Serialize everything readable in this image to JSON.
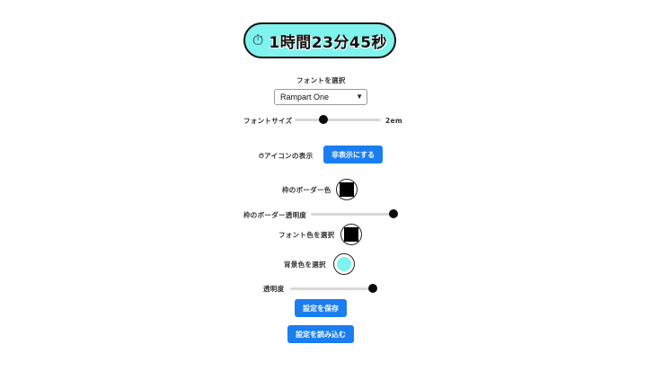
{
  "timer": {
    "icon": "stopwatch-icon",
    "icon_glyph": "⏱",
    "text": "1時間23分45秒"
  },
  "font_select": {
    "label": "フォントを選択",
    "value": "Rampart One"
  },
  "font_size": {
    "label": "フォントサイズ",
    "value_label": "2em",
    "level": 0.33
  },
  "icon_toggle": {
    "label": "⏱アイコンの表示",
    "button": "非表示にする"
  },
  "border_color": {
    "label": "枠のボーダー色",
    "color": "#000000"
  },
  "border_opacity": {
    "label": "枠のボーダー透明度",
    "level": 1.0
  },
  "font_color": {
    "label": "フォント色を選択",
    "color": "#000000"
  },
  "bg_color": {
    "label": "背景色を選択",
    "color": "#7ff3ee"
  },
  "opacity": {
    "label": "透明度",
    "level": 0.92
  },
  "buttons": {
    "save": "設定を保存",
    "load": "設定を読み込む"
  }
}
